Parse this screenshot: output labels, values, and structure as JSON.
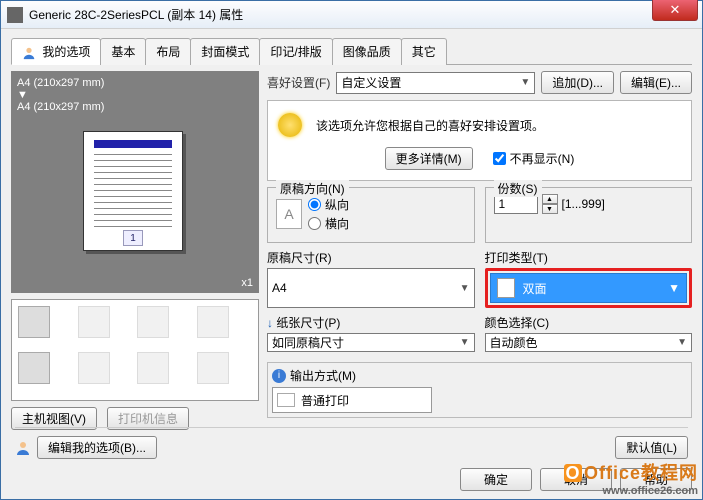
{
  "window": {
    "title": "Generic 28C-2SeriesPCL (副本 14) 属性"
  },
  "tabs": {
    "my_options": "我的选项",
    "basic": "基本",
    "layout": "布局",
    "cover_mode": "封面模式",
    "stamp": "印记/排版",
    "image_quality": "图像品质",
    "other": "其它"
  },
  "preview": {
    "line1": "A4 (210x297 mm)",
    "arrow": "▼",
    "line2": "A4 (210x297 mm)",
    "page_num": "1",
    "scale": "x1"
  },
  "buttons": {
    "host_view": "主机视图(V)",
    "printer_info": "打印机信息",
    "add": "追加(D)...",
    "edit": "编辑(E)...",
    "more_details": "更多详情(M)",
    "edit_my_options": "编辑我的选项(B)...",
    "defaults": "默认值(L)",
    "ok": "确定",
    "cancel": "取消",
    "help": "帮助"
  },
  "prefs": {
    "label": "喜好设置(F)",
    "value": "自定义设置"
  },
  "tip": {
    "text": "该选项允许您根据自己的喜好安排设置项。",
    "checkbox": "不再显示(N)"
  },
  "orientation": {
    "label": "原稿方向(N)",
    "portrait": "纵向",
    "landscape": "横向"
  },
  "copies": {
    "label": "份数(S)",
    "value": "1",
    "range": "[1...999]"
  },
  "original_size": {
    "label": "原稿尺寸(R)",
    "value": "A4"
  },
  "paper_size": {
    "label": "纸张尺寸(P)",
    "value": "如同原稿尺寸",
    "icon": "↓"
  },
  "print_type": {
    "label": "打印类型(T)",
    "value": "双面"
  },
  "color": {
    "label": "颜色选择(C)",
    "value": "自动颜色"
  },
  "output": {
    "label": "输出方式(M)",
    "value": "普通打印"
  },
  "watermark": {
    "line1": "Office教程网",
    "line2": "www.office26.com"
  }
}
